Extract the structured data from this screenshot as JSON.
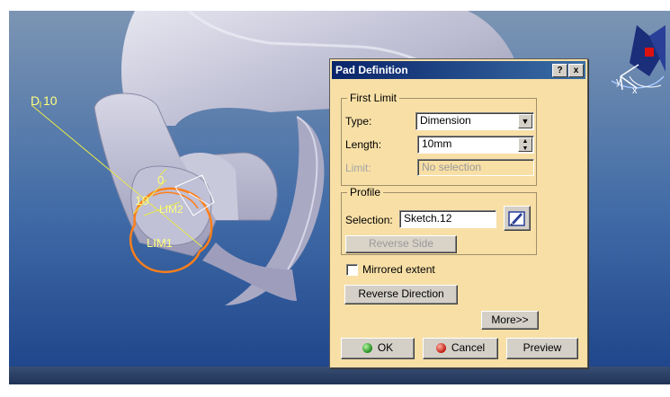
{
  "viewport": {
    "annotations": {
      "diameter_label": "D 10",
      "dim_10": "10",
      "dim_0": "0",
      "lim1": "LIM1",
      "lim2": "LIM2"
    },
    "compass": {
      "axis_x": "x",
      "axis_y": "y"
    },
    "colors": {
      "bg_top": "#6b86a6",
      "bg_bottom": "#1f4a92",
      "part": "#c8c8dc",
      "sketch": "#ff7f1a",
      "dimension": "#e8e84a"
    }
  },
  "dialog": {
    "title": "Pad Definition",
    "help_button": "?",
    "close_button": "x",
    "first_limit": {
      "legend": "First Limit",
      "type_label": "Type:",
      "type_value": "Dimension",
      "length_label": "Length:",
      "length_value": "10mm",
      "limit_label": "Limit:",
      "limit_value": "No selection"
    },
    "profile": {
      "legend": "Profile",
      "selection_label": "Selection:",
      "selection_value": "Sketch.12",
      "reverse_side_label": "Reverse Side"
    },
    "mirrored_extent_label": "Mirrored extent",
    "mirrored_extent_checked": false,
    "reverse_direction_label": "Reverse Direction",
    "more_label": "More>>",
    "ok_label": "OK",
    "cancel_label": "Cancel",
    "preview_label": "Preview"
  }
}
